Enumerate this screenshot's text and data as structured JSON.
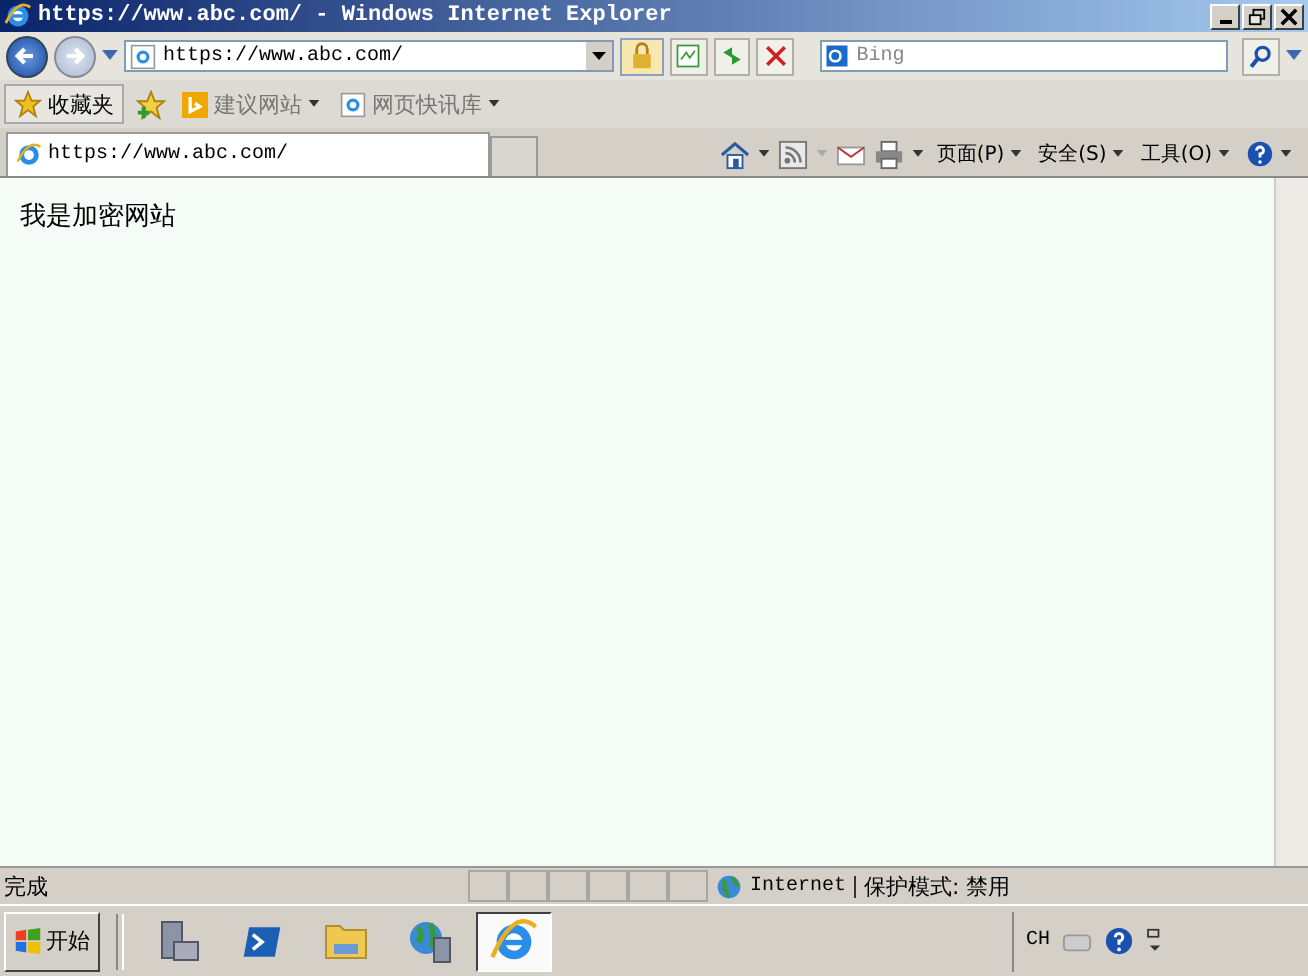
{
  "window": {
    "title": "https://www.abc.com/ - Windows Internet Explorer"
  },
  "address_bar": {
    "value": "https://www.abc.com/"
  },
  "search": {
    "placeholder": "Bing"
  },
  "favorites_bar": {
    "favorites_button": "收藏夹",
    "items": [
      {
        "label": "建议网站",
        "kind": "suggested"
      },
      {
        "label": "网页快讯库",
        "kind": "slices"
      }
    ]
  },
  "tabs": [
    {
      "label": "https://www.abc.com/",
      "selected": true
    },
    {
      "selected": false
    }
  ],
  "command_bar": {
    "menus": [
      "页面(P)",
      "安全(S)",
      "工具(O)"
    ]
  },
  "page": {
    "text": "我是加密网站"
  },
  "status_bar": {
    "status": "完成",
    "zone": "Internet",
    "protected_mode": "保护模式: 禁用"
  },
  "taskbar": {
    "start": "开始",
    "apps": [
      {
        "kind": "server",
        "selected": false
      },
      {
        "kind": "shell",
        "selected": false
      },
      {
        "kind": "folder",
        "selected": false
      },
      {
        "kind": "network",
        "selected": false
      },
      {
        "kind": "ie",
        "selected": true
      }
    ],
    "language": "CH"
  }
}
